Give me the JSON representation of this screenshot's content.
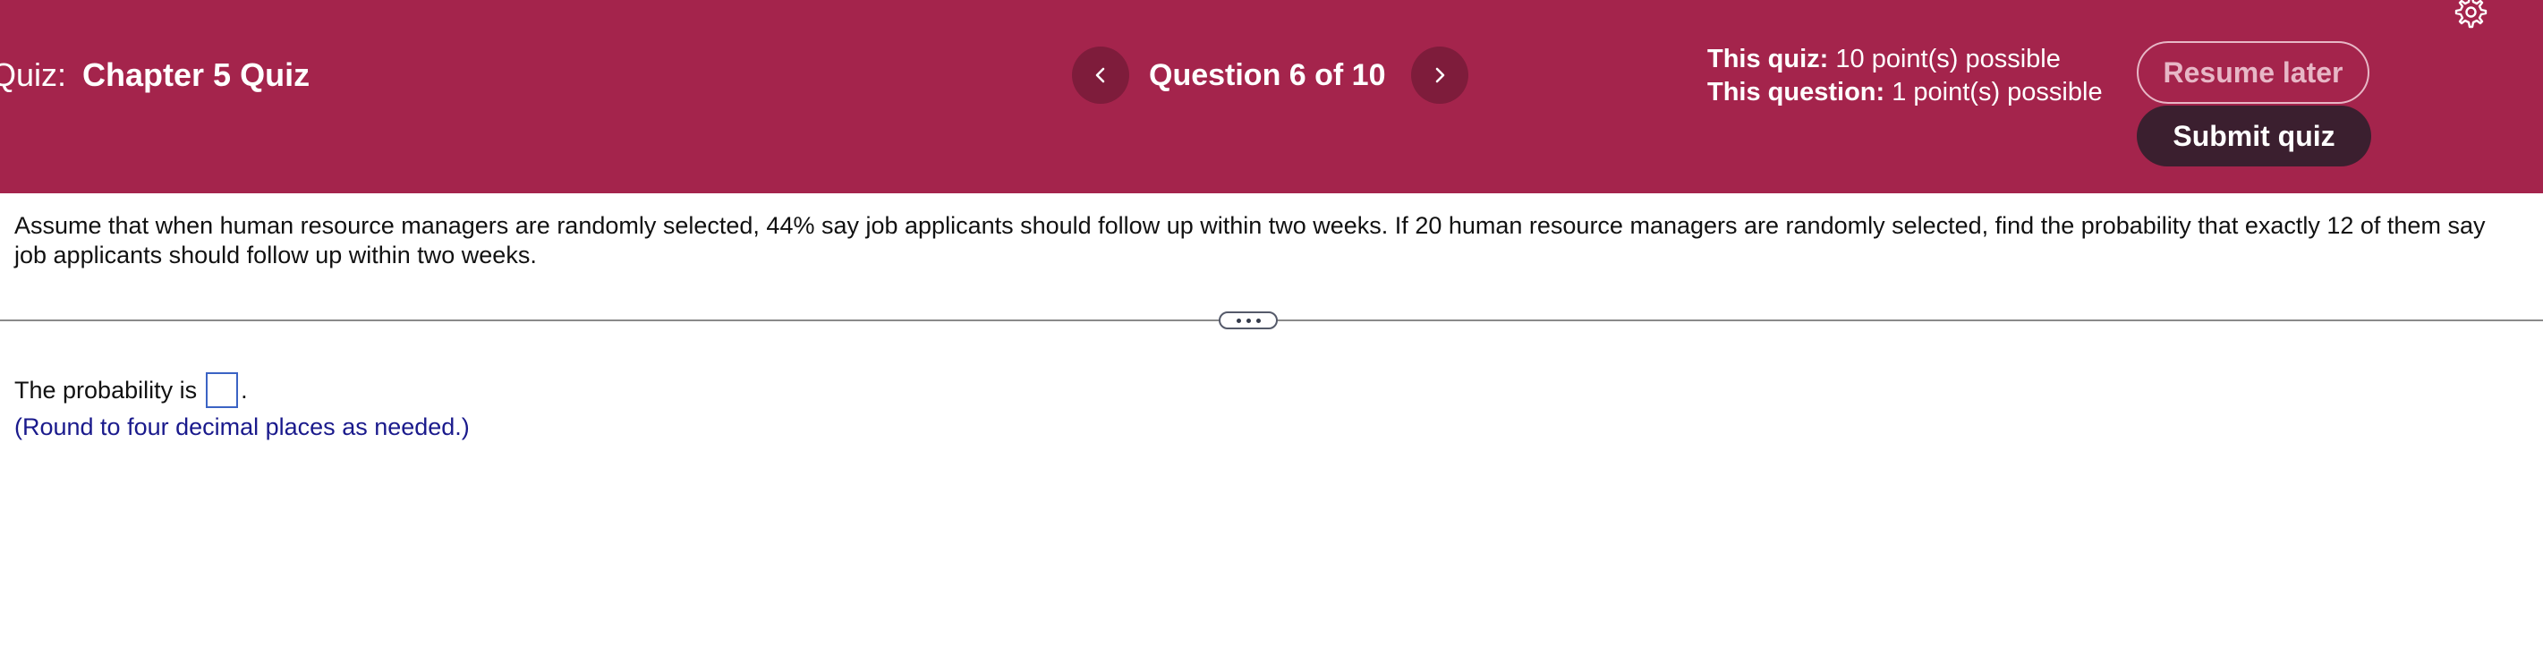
{
  "header": {
    "quiz_prefix": "Quiz:",
    "quiz_name": "Chapter 5 Quiz",
    "question_label": "Question 6 of 10",
    "quiz_points_label": "This quiz:",
    "quiz_points_value": " 10 point(s) possible",
    "question_points_label": "This question:",
    "question_points_value": " 1 point(s) possible",
    "resume_label": "Resume later",
    "submit_label": "Submit quiz",
    "icons": {
      "prev": "chevron-left-icon",
      "next": "chevron-right-icon",
      "settings": "gear-icon"
    },
    "colors": {
      "header_bg": "#a4244c",
      "nav_btn_bg": "#7e1c3b",
      "submit_bg": "#3b1f2f",
      "resume_border": "#e7b7c6"
    }
  },
  "question": {
    "text": "Assume that when human resource managers are randomly selected, 44% say job applicants should follow up within two weeks. If 20 human resource managers are randomly selected, find the probability that exactly 12 of them say job applicants should follow up within two weeks."
  },
  "answer": {
    "prefix": "The probability is",
    "value": "",
    "suffix": ".",
    "hint": "(Round to four decimal places as needed.)"
  }
}
